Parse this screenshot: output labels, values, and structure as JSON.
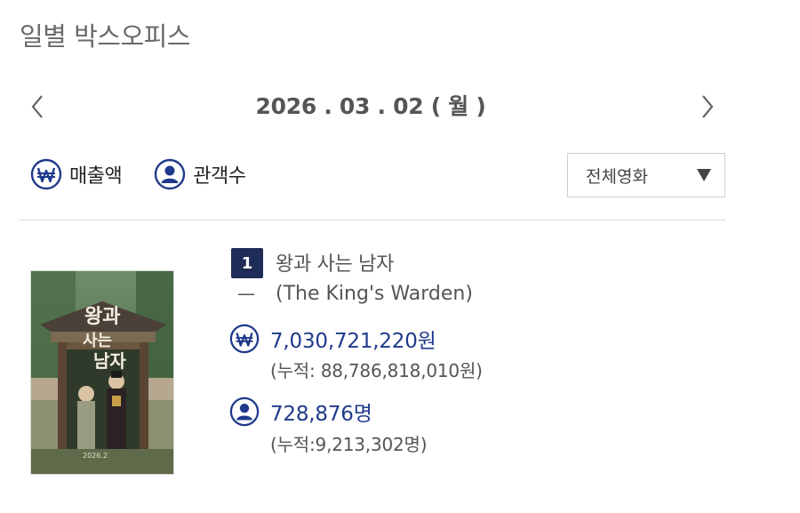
{
  "page": {
    "title": "일별 박스오피스"
  },
  "date_nav": {
    "date": "2026 . 03 . 02 ( 월 )",
    "prev_icon": "chevron-left-icon",
    "next_icon": "chevron-right-icon"
  },
  "toggles": {
    "sales": {
      "label": "매출액",
      "icon": "won-icon"
    },
    "audience": {
      "label": "관객수",
      "icon": "person-icon"
    }
  },
  "filter": {
    "selected": "전체영화",
    "icon": "triangle-down-icon"
  },
  "movie": {
    "rank": "1",
    "rank_change": "—",
    "title": "왕과 사는 남자",
    "title_en": "(The King's Warden)",
    "poster_text": "왕과 사는 남자",
    "sales": "7,030,721,220원",
    "sales_cumulative": "(누적: 88,786,818,010원)",
    "audience": "728,876명",
    "audience_cumulative": "(누적:9,213,302명)"
  },
  "colors": {
    "accent": "#1f3a8a",
    "badge": "#1f2c57",
    "text_muted": "#555555"
  }
}
